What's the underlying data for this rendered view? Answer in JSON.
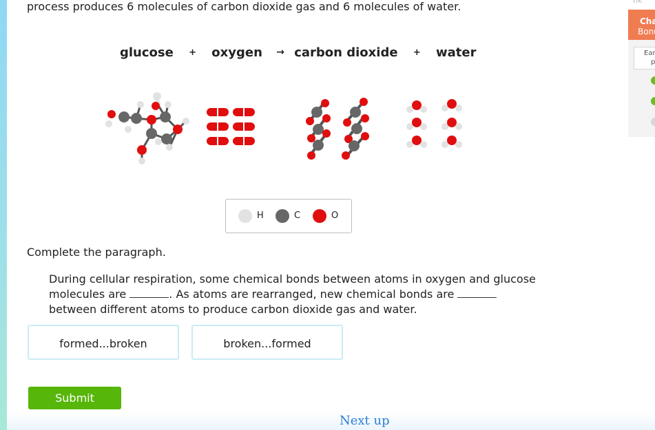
{
  "question": {
    "intro_text": "process produces 6 molecules of carbon dioxide gas and 6 molecules of water.",
    "equation": {
      "glucose": "glucose",
      "plus1": "+",
      "oxygen": "oxygen",
      "arrow": "→",
      "carbon_dioxide": "carbon dioxide",
      "plus2": "+",
      "water": "water"
    },
    "legend": [
      {
        "label": "H",
        "color": "#e2e2e2"
      },
      {
        "label": "C",
        "color": "#676767"
      },
      {
        "label": "O",
        "color": "#e00e0e"
      }
    ],
    "instruction": "Complete the paragraph.",
    "paragraph": {
      "part1": "During cellular respiration, some chemical bonds between atoms in oxygen and glucose molecules are ",
      "part2": ". As atoms are rearranged, new chemical bonds are ",
      "part3": " between different atoms to produce carbon dioxide gas and water."
    },
    "choices": [
      "formed...broken",
      "broken...formed"
    ],
    "submit_label": "Submit"
  },
  "footer": {
    "next_up": "Next up"
  },
  "sidebar": {
    "top_text": "nk",
    "challenge_title": "Cha",
    "challenge_subtitle": "Bonu",
    "earn_text_1": "Ear",
    "earn_text_2": "p"
  },
  "colors": {
    "accent_green": "#56b60a",
    "challenge_orange": "#f07c52",
    "link_blue": "#2a7fd4",
    "choice_border": "#c9ecf4"
  }
}
